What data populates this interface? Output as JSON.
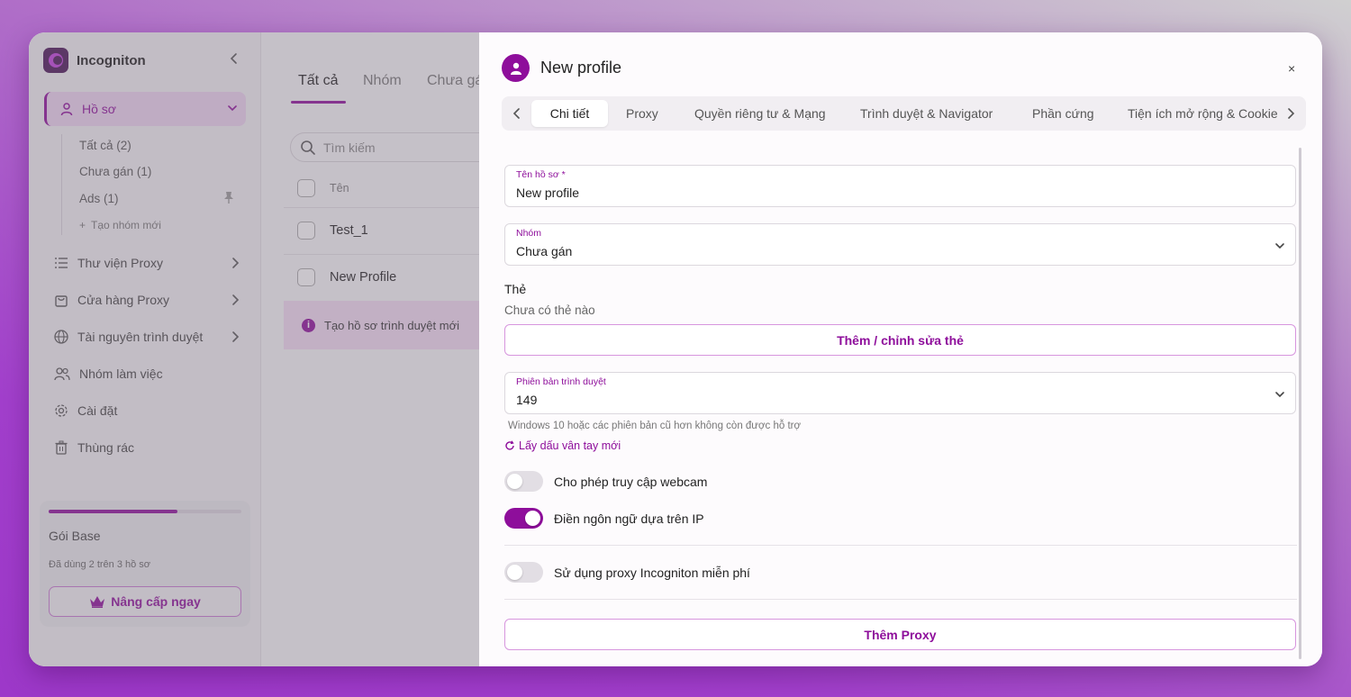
{
  "sidebar": {
    "app_name": "Incogniton",
    "profiles_label": "Hồ sơ",
    "groups": [
      {
        "label": "Tất cả (2)"
      },
      {
        "label": "Chưa gán (1)"
      },
      {
        "label": "Ads (1)"
      }
    ],
    "new_group_label": "Tạo nhóm mới",
    "items": [
      {
        "label": "Thư viện Proxy",
        "icon": "list-icon"
      },
      {
        "label": "Cửa hàng Proxy",
        "icon": "shopping-bag-icon"
      },
      {
        "label": "Tài nguyên trình duyệt",
        "icon": "globe-icon"
      },
      {
        "label": "Nhóm làm việc",
        "icon": "users-icon"
      },
      {
        "label": "Cài đặt",
        "icon": "gear-icon"
      },
      {
        "label": "Thùng rác",
        "icon": "trash-icon"
      }
    ],
    "plan": {
      "title": "Gói Base",
      "usage": "Đã dùng 2 trên 3 hồ sơ",
      "usage_fraction": 0.667,
      "upgrade_label": "Nâng cấp ngay"
    }
  },
  "main": {
    "tabs": [
      "Tất cả",
      "Nhóm",
      "Chưa gá"
    ],
    "search_placeholder": "Tìm kiếm",
    "column_name": "Tên",
    "rows": [
      "Test_1",
      "New Profile"
    ],
    "banner": "Tạo hồ sơ trình duyệt mới"
  },
  "drawer": {
    "title": "New profile",
    "close": "×",
    "tabs": [
      "Chi tiết",
      "Proxy",
      "Quyền riêng tư & Mạng",
      "Trình duyệt & Navigator",
      "Phần cứng",
      "Tiện ích mở rộng & Cookie"
    ],
    "active_tab": "Chi tiết",
    "profile_name_label": "Tên hồ sơ *",
    "profile_name_value": "New profile",
    "group_label": "Nhóm",
    "group_value": "Chưa gán",
    "tags_label": "Thẻ",
    "tags_empty": "Chưa có thẻ nào",
    "tags_button": "Thêm / chỉnh sửa thẻ",
    "browser_version_label": "Phiên bản trình duyệt",
    "browser_version_value": "149",
    "browser_hint": "Windows 10 hoặc các phiên bản cũ hơn không còn được hỗ trợ",
    "new_fingerprint_link": "Lấy dấu vân tay mới",
    "toggles": [
      {
        "label": "Cho phép truy cập webcam",
        "on": false
      },
      {
        "label": "Điền ngôn ngữ dựa trên IP",
        "on": true
      },
      {
        "label": "Sử dụng proxy Incogniton miễn phí",
        "on": false
      }
    ],
    "add_proxy_button": "Thêm Proxy"
  },
  "colors": {
    "accent": "#8e0e9b",
    "accent_light": "#efd6f2"
  }
}
